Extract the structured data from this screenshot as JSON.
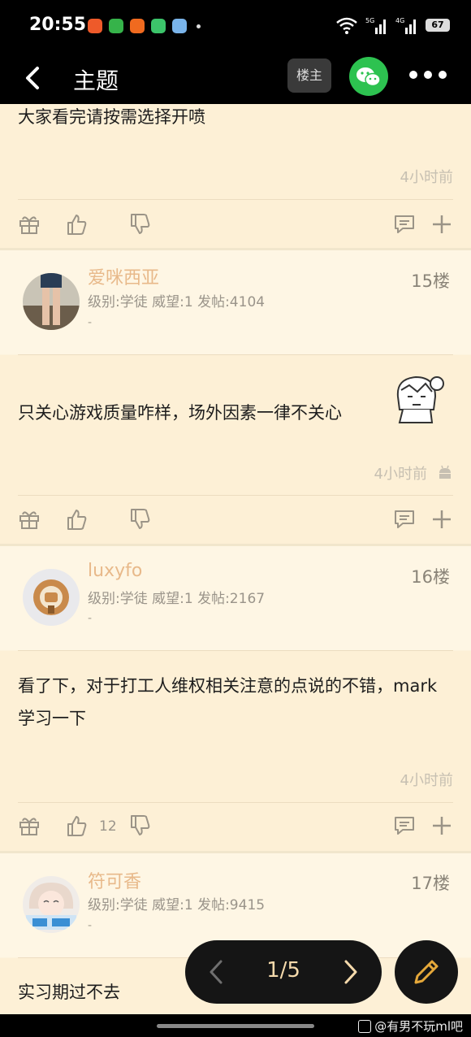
{
  "status": {
    "time": "20:55",
    "network": "5G 4G",
    "battery": "67"
  },
  "header": {
    "title": "主题",
    "owner_label": "楼主"
  },
  "post_top": {
    "text": "大家看完请按需选择开喷",
    "time": "4小时前"
  },
  "posts": [
    {
      "username": "爱咪西亚",
      "meta": "级别:学徒 威望:1 发帖:4104",
      "sig": "-",
      "floor": "15楼",
      "text": "只关心游戏质量咋样，场外因素一律不关心",
      "time": "4小时前"
    },
    {
      "username": "luxyfo",
      "meta": "级别:学徒 威望:1 发帖:2167",
      "sig": "-",
      "floor": "16楼",
      "text": "看了下，对于打工人维权相关注意的点说的不错，mark学习一下",
      "time": "4小时前",
      "likes": "12"
    },
    {
      "username": "符可香",
      "meta": "级别:学徒 威望:1 发帖:9415",
      "sig": "-",
      "floor": "17楼",
      "text": "实习期过不去"
    }
  ],
  "pager": {
    "label": "1/5"
  },
  "watermark": "@有男不玩ml吧",
  "colors": {
    "background": "#fdf3dc",
    "username": "#e8b98a",
    "pager_text": "#f4d9ab",
    "wechat": "#2dc250"
  }
}
